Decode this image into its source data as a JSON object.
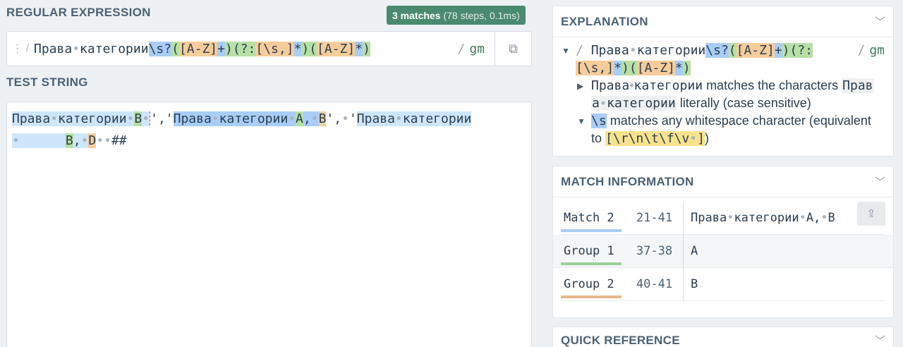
{
  "regex_section": {
    "label": "REGULAR EXPRESSION",
    "badge_count": "3 matches",
    "badge_detail": "(78 steps, 0.1ms)",
    "handle_icon": "drag-handle-icon",
    "open_slash": "/",
    "pattern": {
      "literal_1": "Права",
      "literal_2": "категории",
      "ws": "\\s?",
      "paren_open": "(",
      "class_1": "[A-Z]",
      "plus": "+",
      "paren_close": ")",
      "nc_open": "(?:",
      "class_2": "[\\s,]",
      "star": "*",
      "paren2_open": "(",
      "class_3": "[A-Z]",
      "star2": "*",
      "paren2_close": ")"
    },
    "flags_slash": "/",
    "flags": "gm",
    "copy_icon": "copy-icon"
  },
  "test_section": {
    "label": "TEST STRING",
    "parts": {
      "m1_word1": "Права",
      "m1_word2": "категории",
      "m1_g1": "B",
      "sep_1": "','",
      "m2_word1": "Права",
      "m2_word2": "категории",
      "m2_g1": "A",
      "m2_comma": ",",
      "m2_g2": "B",
      "sep_2": "',",
      "sep_3": "'",
      "m3_word1": "Права",
      "m3_word2": "категории",
      "m3_g1": "B",
      "m3_comma": ",",
      "m3_g2": "D",
      "tail": "##"
    }
  },
  "explanation": {
    "title": "EXPLANATION",
    "slash": "/",
    "pattern_line1_a": "Права",
    "pattern_line1_b": "категории",
    "pattern_ws": "\\s?",
    "pattern_open": "(",
    "pattern_class1": "[A-Z]",
    "pattern_plus": "+",
    "pattern_close": ")",
    "pattern_nc": "(?:",
    "pattern_class2": "[\\s,]",
    "pattern_star": "*",
    "pattern_close2": ")",
    "pattern_open2": "(",
    "pattern_class3": "[A-Z]",
    "pattern_star2": "*",
    "pattern_close3": ")",
    "flags_slash": "/",
    "flags": "gm",
    "item1_code_a": "Прав",
    "item1_code_b": "а",
    "item1_code_c": "категории",
    "item1_text_a": "Права",
    "item1_text_b": "категории",
    "item1_middle": "matches the characters",
    "item1_end": "literally (case sensitive)",
    "item2_code": "\\s",
    "item2_text": "matches any whitespace character (equivalent to",
    "item2_class": "[\\r\\n\\t\\f\\v",
    "item2_class_end": "]",
    "item2_close": ")"
  },
  "match_info": {
    "title": "MATCH INFORMATION",
    "rows": [
      {
        "label": "Match 2",
        "range": "21-41",
        "value_a": "Права",
        "value_b": "категории",
        "value_c": "A,",
        "value_d": "B",
        "bar": "#a8cdf7"
      },
      {
        "label": "Group 1",
        "range": "37-38",
        "value": "A",
        "bar": "#9dd19a"
      },
      {
        "label": "Group 2",
        "range": "40-41",
        "value": "B",
        "bar": "#e8b98a"
      }
    ]
  },
  "quick_reference": {
    "title": "QUICK REFERENCE"
  },
  "colors": {
    "badge": "#4a8a6e",
    "flags": "#3b7d52",
    "match_blue": "#a8cdf7",
    "group_green": "#b7e0a5",
    "group_orange": "#f6cd9a"
  }
}
